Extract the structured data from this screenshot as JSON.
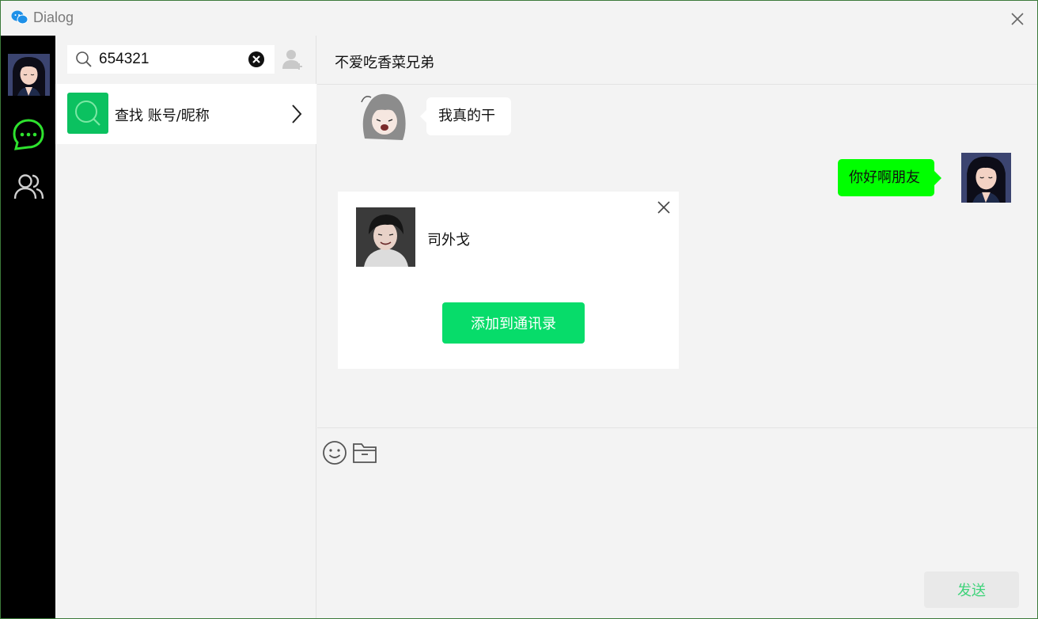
{
  "window": {
    "title": "Dialog",
    "app_icon": "wechat-icon",
    "close_icon": "close-icon"
  },
  "nav": {
    "avatar": "user-avatar",
    "items": [
      {
        "icon": "chat-bubble-icon",
        "active": true,
        "color": "#2ee22e"
      },
      {
        "icon": "contacts-icon",
        "active": false
      }
    ]
  },
  "search": {
    "value": "654321",
    "search_icon": "search-icon",
    "clear_icon": "clear-icon",
    "add_friend_icon": "add-friend-icon"
  },
  "find_row": {
    "label": "查找 账号/昵称",
    "icon": "search-icon",
    "chevron": "chevron-right-icon"
  },
  "chat": {
    "contact_name": "不爱吃香菜兄弟",
    "messages": [
      {
        "side": "left",
        "text": "我真的干"
      },
      {
        "side": "right",
        "text": "你好啊朋友"
      }
    ],
    "card": {
      "name": "司外戈",
      "add_button": "添加到通讯录"
    },
    "send_button": "发送"
  },
  "colors": {
    "accent_green": "#07dc6a",
    "bubble_green": "#00ff00",
    "nav_bg": "#000000",
    "bg": "#f3f3f3"
  }
}
